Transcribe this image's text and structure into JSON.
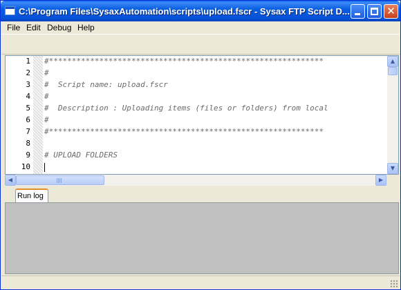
{
  "window": {
    "title": "C:\\Program Files\\SysaxAutomation\\scripts\\upload.fscr - Sysax FTP Script D...",
    "controls": {
      "minimize_icon": "minimize-icon",
      "maximize_icon": "maximize-icon",
      "close_glyph": "✕"
    }
  },
  "menu": {
    "items": [
      {
        "label": "File"
      },
      {
        "label": "Edit"
      },
      {
        "label": "Debug"
      },
      {
        "label": "Help"
      }
    ]
  },
  "editor": {
    "lines": [
      {
        "number": "1",
        "text": "#************************************************************"
      },
      {
        "number": "2",
        "text": "#"
      },
      {
        "number": "3",
        "text": "#  Script name: upload.fscr"
      },
      {
        "number": "4",
        "text": "#"
      },
      {
        "number": "5",
        "text": "#  Description : Uploading items (files or folders) from local"
      },
      {
        "number": "6",
        "text": "#"
      },
      {
        "number": "7",
        "text": "#************************************************************"
      },
      {
        "number": "8",
        "text": ""
      },
      {
        "number": "9",
        "text": "# UPLOAD FOLDERS"
      },
      {
        "number": "10",
        "text": ""
      }
    ]
  },
  "scrollbars": {
    "up_arrow": "▲",
    "down_arrow": "▼",
    "left_arrow": "◀",
    "right_arrow": "▶"
  },
  "bottom_panel": {
    "tabs": [
      {
        "label": "Run log"
      }
    ]
  },
  "colors": {
    "title_bar": "#0550d8",
    "comment_text": "#6a6a6a",
    "log_background": "#c0c0c0",
    "tab_accent": "#e68b2c"
  }
}
